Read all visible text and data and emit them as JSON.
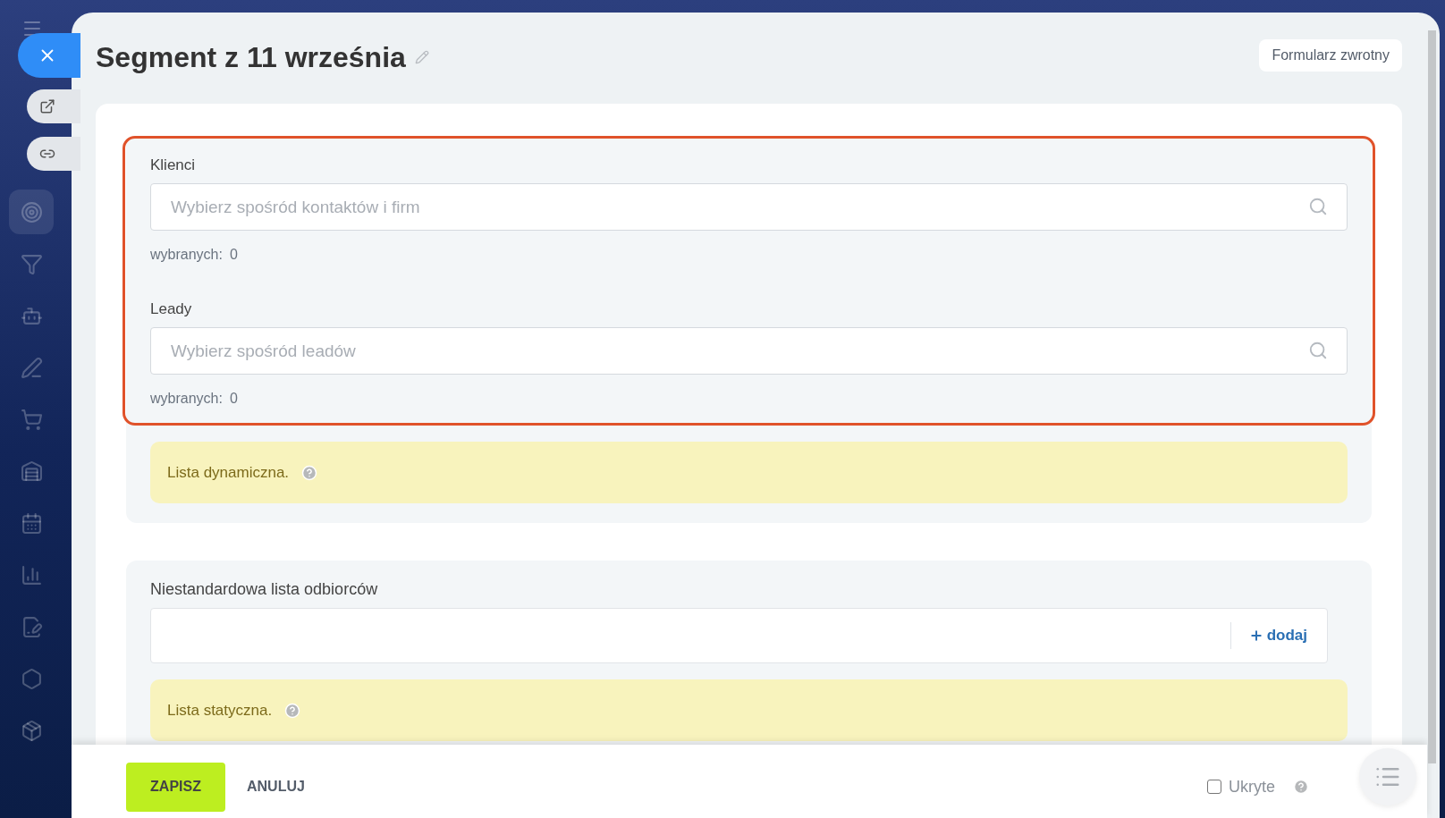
{
  "title": "Segment z 11 września",
  "feedback_button": "Formularz zwrotny",
  "entity_fields": [
    {
      "label": "Klienci",
      "placeholder": "Wybierz spośród kontaktów i firm",
      "count_label": "wybranych:",
      "count": "0"
    },
    {
      "label": "Leady",
      "placeholder": "Wybierz spośród leadów",
      "count_label": "wybranych:",
      "count": "0"
    }
  ],
  "dynamic_notice": "Lista dynamiczna.",
  "custom_list": {
    "label": "Niestandardowa lista odbiorców",
    "add_button": "dodaj"
  },
  "static_notice": "Lista statyczna.",
  "footer": {
    "save": "ZAPISZ",
    "cancel": "ANULUJ",
    "hidden": {
      "label": "Ukryte",
      "checked": false
    }
  }
}
